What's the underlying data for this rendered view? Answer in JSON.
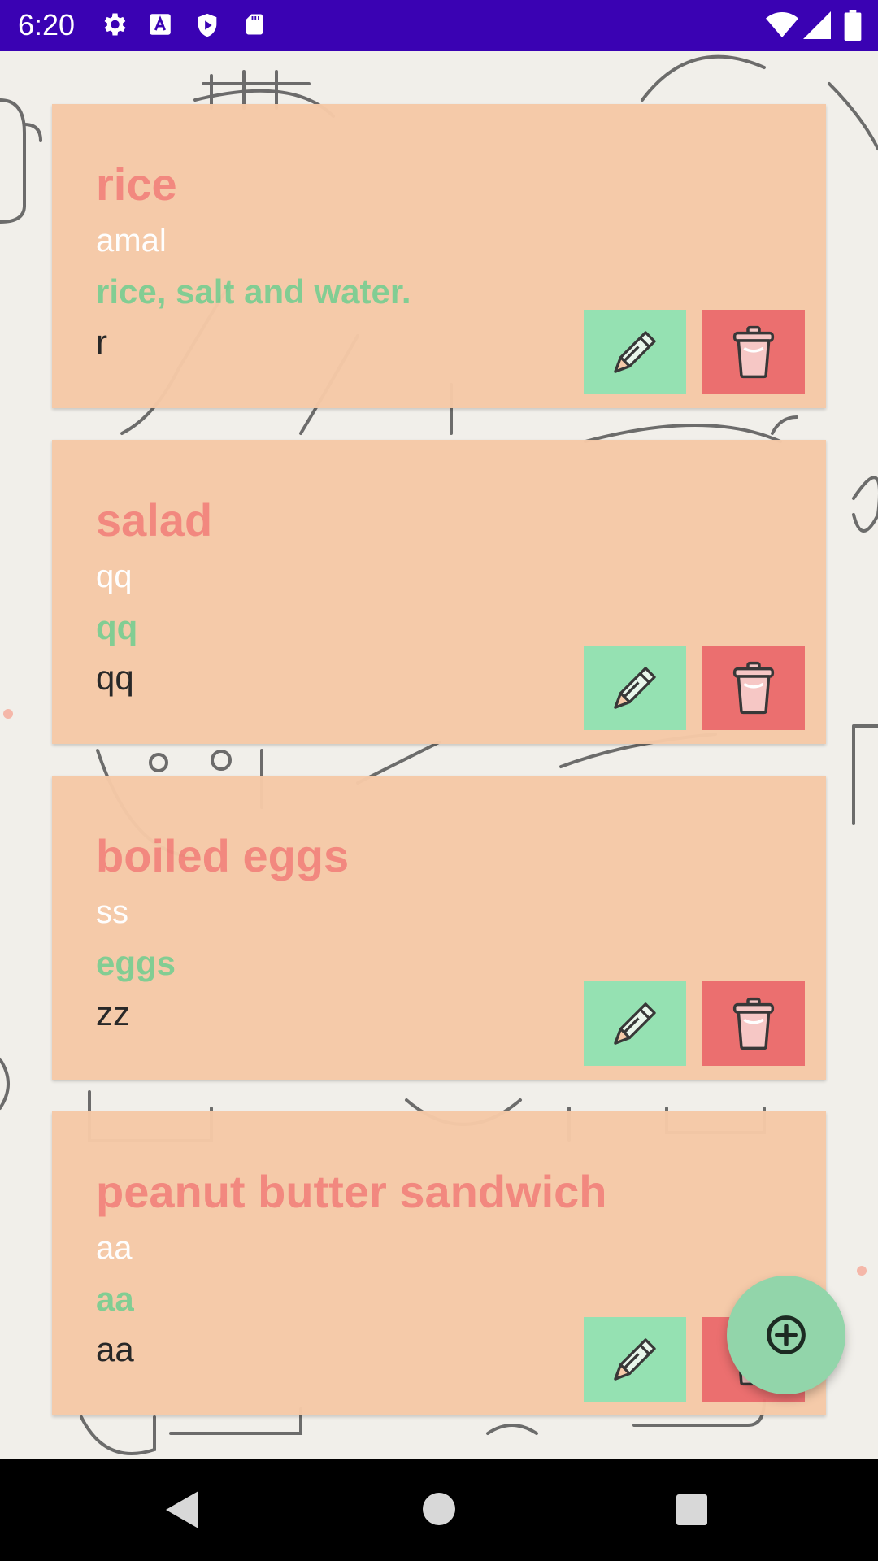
{
  "status_bar": {
    "time": "6:20",
    "left_icons": [
      "settings-icon",
      "text-a-icon",
      "shield-play-icon",
      "sd-card-icon"
    ],
    "right_icons": [
      "wifi-icon",
      "signal-icon",
      "battery-icon"
    ]
  },
  "recipes": [
    {
      "title": "rice",
      "author": "amal",
      "ingredients": "rice, salt and water.",
      "notes": "r"
    },
    {
      "title": "salad",
      "author": "qq",
      "ingredients": "qq",
      "notes": "qq"
    },
    {
      "title": "boiled eggs",
      "author": "ss",
      "ingredients": "eggs",
      "notes": "zz"
    },
    {
      "title": "peanut butter sandwich",
      "author": "aa",
      "ingredients": "aa",
      "notes": "aa"
    }
  ],
  "actions": {
    "edit_icon": "pencil-icon",
    "delete_icon": "trash-icon",
    "add_icon": "add-circle-icon"
  },
  "nav_bar": {
    "buttons": [
      "back-icon",
      "home-icon",
      "recents-icon"
    ]
  },
  "colors": {
    "status_bar": "#3a02b3",
    "card": "#f6c9a7",
    "title": "#f3857c",
    "ingredients": "#7fcc91",
    "edit_button": "#93e1b1",
    "delete_button": "#eb6b6c",
    "fab": "#92d5aa"
  }
}
